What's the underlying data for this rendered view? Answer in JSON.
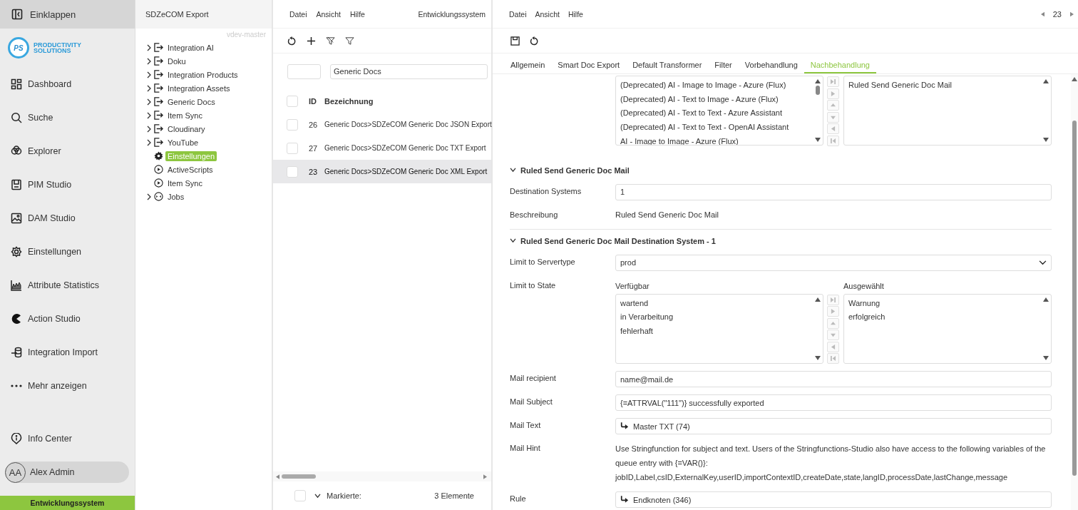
{
  "sidebar": {
    "collapse": "Einklappen",
    "logo": {
      "mark": "PS",
      "name": [
        "PRODUCTIVITY",
        "SOLUTIONS"
      ]
    },
    "items": [
      {
        "label": "Dashboard"
      },
      {
        "label": "Suche"
      },
      {
        "label": "Explorer"
      },
      {
        "label": "PIM Studio"
      },
      {
        "label": "DAM Studio"
      },
      {
        "label": "Einstellungen"
      },
      {
        "label": "Attribute Statistics"
      },
      {
        "label": "Action Studio"
      },
      {
        "label": "Integration Import"
      },
      {
        "label": "Mehr anzeigen"
      }
    ],
    "info": "Info Center",
    "user": {
      "initials": "AA",
      "name": "Alex Admin"
    },
    "environment": "Entwicklungssystem"
  },
  "tree": {
    "title": "SDZeCOM Export",
    "version": "vdev-master",
    "items": [
      {
        "label": "Integration AI",
        "kind": "folder",
        "expanded": false,
        "selected": false
      },
      {
        "label": "Doku",
        "kind": "folder",
        "expanded": false,
        "selected": false
      },
      {
        "label": "Integration Products",
        "kind": "folder",
        "expanded": false,
        "selected": false
      },
      {
        "label": "Integration Assets",
        "kind": "folder",
        "expanded": false,
        "selected": false
      },
      {
        "label": "Generic Docs",
        "kind": "folder",
        "expanded": false,
        "selected": false
      },
      {
        "label": "Item Sync",
        "kind": "folder",
        "expanded": false,
        "selected": false
      },
      {
        "label": "Cloudinary",
        "kind": "folder",
        "expanded": false,
        "selected": false
      },
      {
        "label": "YouTube",
        "kind": "folder",
        "expanded": false,
        "selected": false
      },
      {
        "label": "Einstellungen",
        "kind": "settings",
        "selected": true
      },
      {
        "label": "ActiveScripts",
        "kind": "script",
        "selected": false
      },
      {
        "label": "Item Sync",
        "kind": "script",
        "selected": false
      },
      {
        "label": "Jobs",
        "kind": "jobs",
        "expanded": false,
        "selected": false
      }
    ]
  },
  "list": {
    "menu": [
      "Datei",
      "Ansicht",
      "Hilfe"
    ],
    "system": "Entwicklungssystem",
    "search": {
      "value": "Generic Docs"
    },
    "columns": [
      "ID",
      "Bezeichnung"
    ],
    "header_checked": false,
    "rows": [
      {
        "id": "26",
        "name": "Generic Docs>SDZeCOM Generic Doc JSON Export",
        "checked": false,
        "selected": false
      },
      {
        "id": "27",
        "name": "Generic Docs>SDZeCOM Generic Doc TXT Export",
        "checked": false,
        "selected": false
      },
      {
        "id": "23",
        "name": "Generic Docs>SDZeCOM Generic Doc XML Export",
        "checked": false,
        "selected": true
      }
    ],
    "footer": {
      "label": "Markierte:",
      "count": "3 Elemente",
      "checked": false
    }
  },
  "detail": {
    "menu": [
      "Datei",
      "Ansicht",
      "Hilfe"
    ],
    "record": "23",
    "tabs": [
      {
        "label": "Allgemein",
        "selected": false
      },
      {
        "label": "Smart Doc Export",
        "selected": false
      },
      {
        "label": "Default Transformer",
        "selected": false
      },
      {
        "label": "Filter",
        "selected": false
      },
      {
        "label": "Vorbehandlung",
        "selected": false
      },
      {
        "label": "Nachbehandlung",
        "selected": true
      }
    ],
    "top_shuttle": {
      "available": [
        "(Deprecated) AI - Image to Image - Azure (Flux)",
        "(Deprecated) AI - Text to Image - Azure (Flux)",
        "(Deprecated) AI - Text to Text - Azure Assistant",
        "(Deprecated) AI - Text to Text - OpenAI Assistant",
        "AI - Image to Image - Azure (Flux)"
      ],
      "chosen": [
        "Ruled Send Generic Doc Mail"
      ]
    },
    "sections": [
      {
        "title": "Ruled Send Generic Doc Mail",
        "expanded": true,
        "fields": [
          {
            "label": "Destination Systems",
            "kind": "input",
            "value": "1"
          },
          {
            "label": "Beschreibung",
            "kind": "text",
            "value": "Ruled Send Generic Doc Mail"
          }
        ]
      },
      {
        "title": "Ruled Send Generic Doc Mail Destination System - 1",
        "expanded": true,
        "fields": [
          {
            "label": "Limit to Servertype",
            "kind": "select",
            "value": "prod"
          },
          {
            "label": "Limit to State",
            "kind": "shuttle",
            "available_header": "Verfügbar",
            "chosen_header": "Ausgewählt",
            "available": [
              "wartend",
              "in Verarbeitung",
              "fehlerhaft"
            ],
            "chosen": [
              "Warnung",
              "erfolgreich"
            ]
          },
          {
            "label": "Mail recipient",
            "kind": "input",
            "value": "name@mail.de"
          },
          {
            "label": "Mail Subject",
            "kind": "input",
            "value": "{=ATTRVAL(\"111\")} successfully exported"
          },
          {
            "label": "Mail Text",
            "kind": "link",
            "value": "Master TXT (74)"
          },
          {
            "label": "Mail Hint",
            "kind": "note",
            "lines": [
              "Use Stringfunction for subject and text. Users of the Stringfunctions-Studio also have access to the following variables of the queue entry with {=VAR()}:",
              "jobID,Label,csID,ExternalKey,userID,importContextID,createDate,state,langID,processDate,lastChange,message"
            ]
          },
          {
            "label": "Rule",
            "kind": "link",
            "value": "Endknoten (346)"
          }
        ]
      }
    ]
  }
}
